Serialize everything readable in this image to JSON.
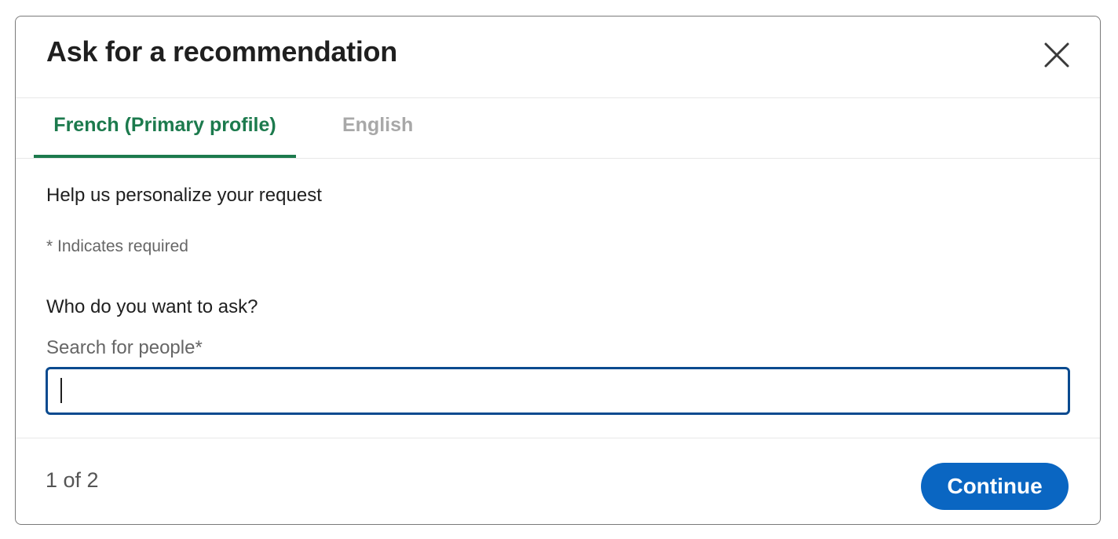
{
  "dialog": {
    "title": "Ask for a recommendation",
    "close_icon": "close-icon"
  },
  "tabs": [
    {
      "label": "French (Primary profile)",
      "active": true
    },
    {
      "label": "English",
      "active": false
    }
  ],
  "form": {
    "intro": "Help us personalize your request",
    "required_note": "* Indicates required",
    "question": "Who do you want to ask?",
    "search_label": "Search for people*",
    "search_value": ""
  },
  "footer": {
    "step": "1 of 2",
    "continue_label": "Continue"
  },
  "colors": {
    "accent_green": "#1c7a4d",
    "primary_blue": "#0a66c2",
    "focus_border": "#0a4a8f"
  }
}
